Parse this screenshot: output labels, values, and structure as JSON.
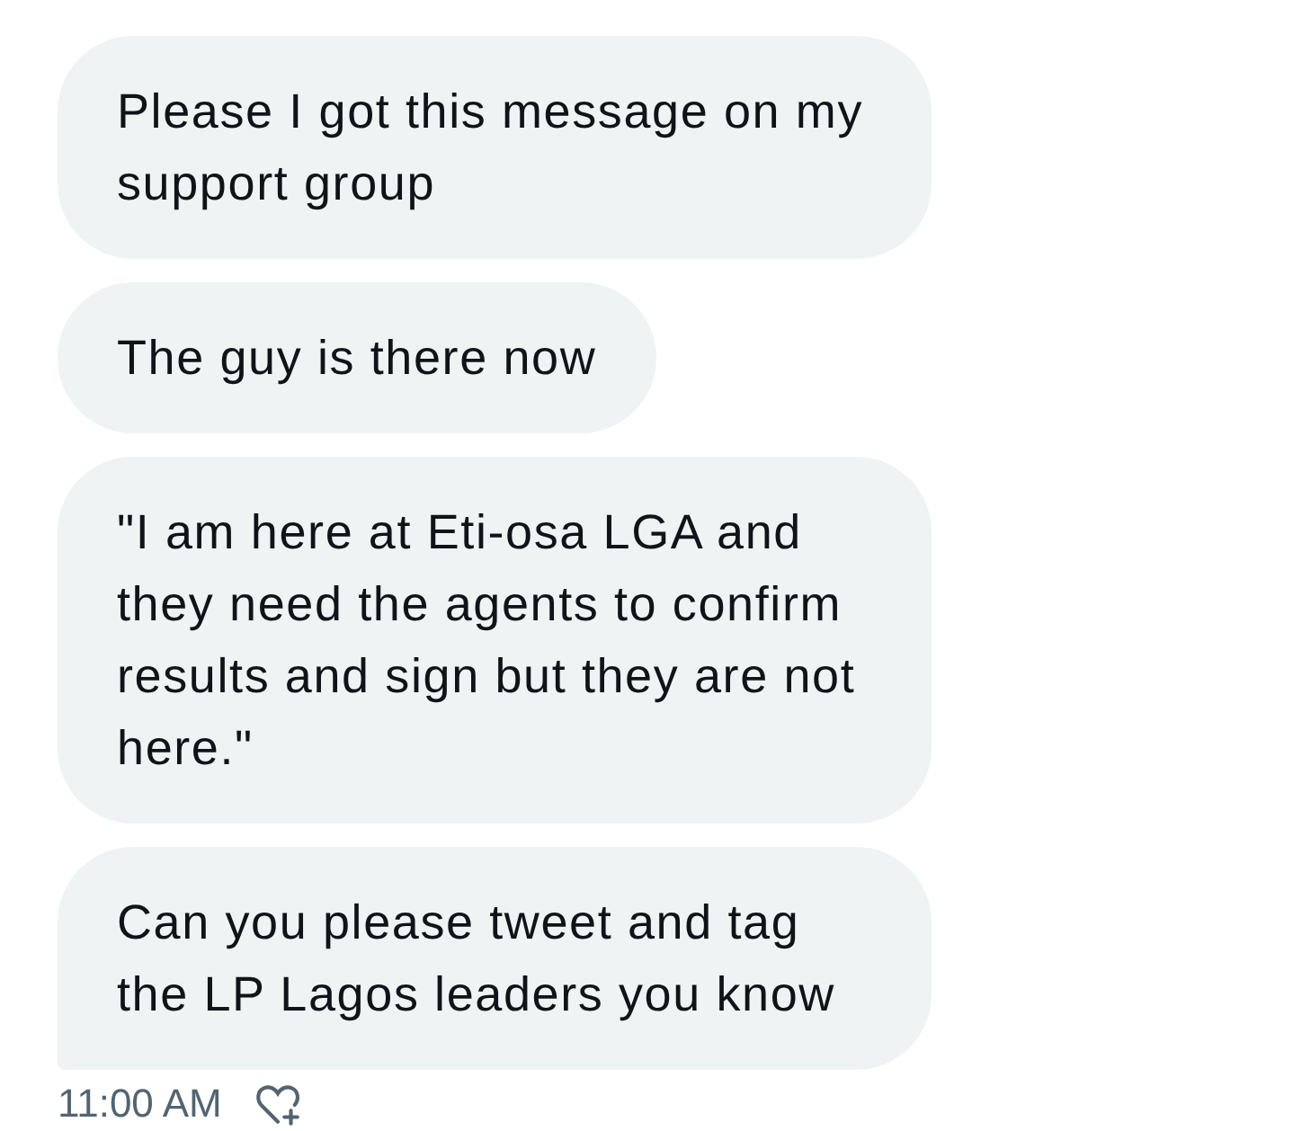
{
  "messages": [
    {
      "text": "Please I got this message on my support group",
      "tail": false
    },
    {
      "text": "The guy is there now",
      "tail": false
    },
    {
      "text": "\"I am here at Eti-osa LGA and they need the agents to confirm results and sign but they are not here.\"",
      "tail": false
    },
    {
      "text": "Can you please tweet and tag the LP Lagos leaders you know",
      "tail": true
    }
  ],
  "timestamp": "11:00 AM"
}
